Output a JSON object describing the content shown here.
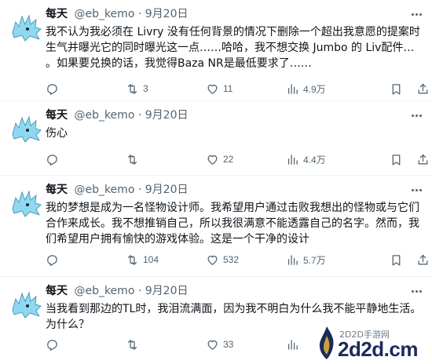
{
  "colors": {
    "text": "#0f1419",
    "muted": "#536471",
    "divider": "#eff3f4",
    "avatar_fill": "#8fd8f0"
  },
  "tweets": [
    {
      "name": "每天",
      "handle": "@eb_kemo",
      "sep": "·",
      "date": "9月20日",
      "text": "我不认为我必须在 Livry 没有任何背景的情况下删除一个超出我意愿的提案时生气并曝光它的同时曝光这一点……哈哈，我不想交换 Jumbo 的 Liv配件… 。如果要兑换的话，我觉得Baza NR是最低要求了……",
      "replies": "",
      "retweets": "3",
      "likes": "11",
      "views": "4.9万"
    },
    {
      "name": "每天",
      "handle": "@eb_kemo",
      "sep": "·",
      "date": "9月20日",
      "text": "伤心",
      "replies": "",
      "retweets": "",
      "likes": "22",
      "views": "4.4万"
    },
    {
      "name": "每天",
      "handle": "@eb_kemo",
      "sep": "·",
      "date": "9月20日",
      "text": "我的梦想是成为一名怪物设计师。我希望用户通过击败我想出的怪物或与它们合作来成长。我不想推销自己，所以我很满意不能透露自己的名字。然而，我们希望用户拥有愉快的游戏体验。这是一个干净的设计",
      "replies": "",
      "retweets": "104",
      "likes": "532",
      "views": "5.7万"
    },
    {
      "name": "每天",
      "handle": "@eb_kemo",
      "sep": "·",
      "date": "9月20日",
      "text": "当我看到那边的TL时，我泪流满面，因为我不明白为什么我不能平静地生活。为什么？",
      "replies": "",
      "retweets": "",
      "likes": "33",
      "views": ""
    }
  ],
  "watermark": {
    "sub": "2D2D手游网",
    "main": "2d2d.cm"
  }
}
